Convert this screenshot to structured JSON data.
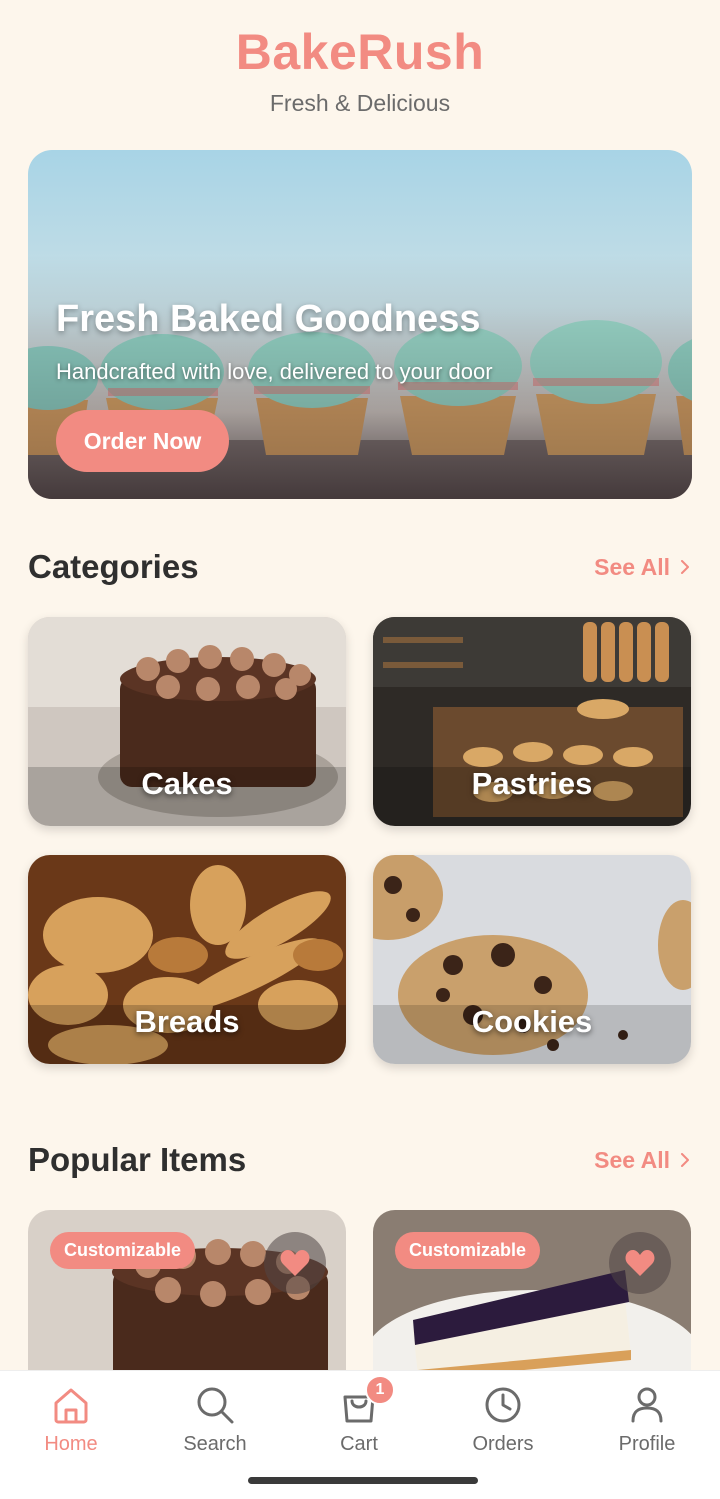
{
  "header": {
    "title": "BakeRush",
    "subtitle": "Fresh & Delicious"
  },
  "hero": {
    "title": "Fresh Baked Goodness",
    "subtitle": "Handcrafted with love, delivered to your door",
    "button_label": "Order Now"
  },
  "categories": {
    "title": "Categories",
    "see_all": "See All",
    "items": [
      {
        "label": "Cakes"
      },
      {
        "label": "Pastries"
      },
      {
        "label": "Breads"
      },
      {
        "label": "Cookies"
      }
    ]
  },
  "popular": {
    "title": "Popular Items",
    "see_all": "See All",
    "items": [
      {
        "badge": "Customizable"
      },
      {
        "badge": "Customizable"
      }
    ]
  },
  "bottom_nav": {
    "items": [
      {
        "label": "Home",
        "icon": "home-icon",
        "active": true
      },
      {
        "label": "Search",
        "icon": "search-icon",
        "active": false
      },
      {
        "label": "Cart",
        "icon": "cart-icon",
        "active": false
      },
      {
        "label": "Orders",
        "icon": "clock-icon",
        "active": false
      },
      {
        "label": "Profile",
        "icon": "profile-icon",
        "active": false
      }
    ],
    "cart_count": "1"
  },
  "colors": {
    "accent": "#F28B82",
    "background": "#FDF6EC",
    "text": "#2f2f2f",
    "muted": "#6b6b6b"
  }
}
